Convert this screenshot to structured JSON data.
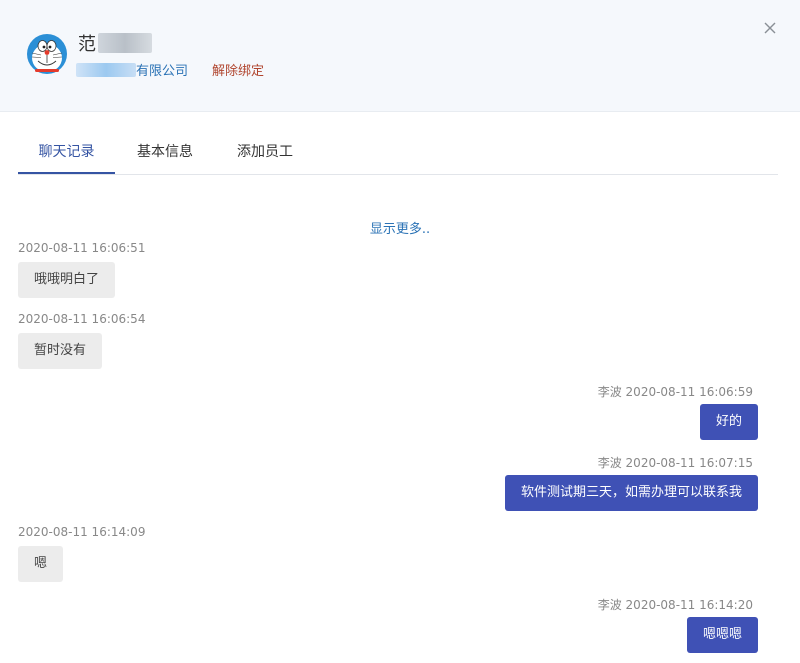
{
  "header": {
    "name": "范",
    "company_suffix": "有限公司",
    "unbind_label": "解除绑定",
    "close_symbol": "×"
  },
  "tabs": [
    {
      "label": "聊天记录",
      "active": true
    },
    {
      "label": "基本信息",
      "active": false
    },
    {
      "label": "添加员工",
      "active": false
    }
  ],
  "chat": {
    "more_label": "显示更多..",
    "messages": [
      {
        "side": "in",
        "timestamp": "2020-08-11 16:06:51",
        "text": "哦哦明白了"
      },
      {
        "side": "in",
        "timestamp": "2020-08-11 16:06:54",
        "text": "暂时没有"
      },
      {
        "side": "out",
        "timestamp": "李波 2020-08-11 16:06:59",
        "text": "好的"
      },
      {
        "side": "out",
        "timestamp": "李波 2020-08-11 16:07:15",
        "text": "软件测试期三天，如需办理可以联系我"
      },
      {
        "side": "in",
        "timestamp": "2020-08-11 16:14:09",
        "text": "嗯"
      },
      {
        "side": "out",
        "timestamp": "李波 2020-08-11 16:14:20",
        "text": "嗯嗯嗯"
      }
    ]
  },
  "colors": {
    "accent": "#3f51b5",
    "link": "#2a72b5",
    "danger_link": "#b0452e",
    "incoming_bubble": "#ececec"
  }
}
